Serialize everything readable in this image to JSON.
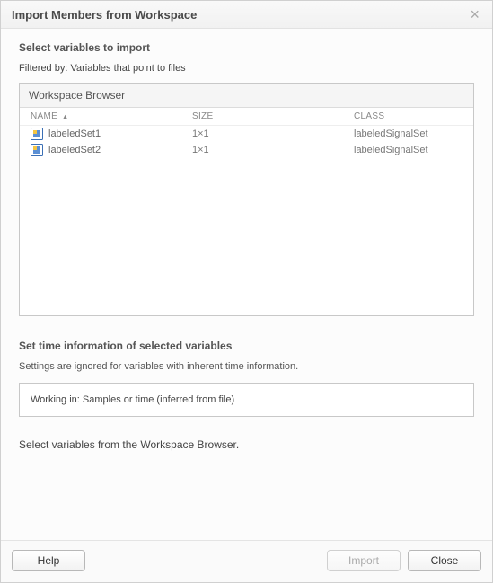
{
  "dialog": {
    "title": "Import Members from Workspace",
    "close_glyph": "×"
  },
  "select_section": {
    "title": "Select variables to import",
    "filter_label": "Filtered by:",
    "filter_value": "Variables that point to files"
  },
  "workspace_browser": {
    "title": "Workspace Browser",
    "columns": {
      "name": "NAME",
      "size": "SIZE",
      "class": "CLASS",
      "sort_indicator": "▲"
    },
    "rows": [
      {
        "name": "labeledSet1",
        "size": "1×1",
        "class": "labeledSignalSet"
      },
      {
        "name": "labeledSet2",
        "size": "1×1",
        "class": "labeledSignalSet"
      }
    ]
  },
  "time_section": {
    "title": "Set time information of selected variables",
    "desc": "Settings are ignored for variables with inherent time information.",
    "working_label": "Working in:",
    "working_value": "Samples or time (inferred from file)"
  },
  "hint": "Select variables from the Workspace Browser.",
  "buttons": {
    "help": "Help",
    "import": "Import",
    "close": "Close"
  }
}
